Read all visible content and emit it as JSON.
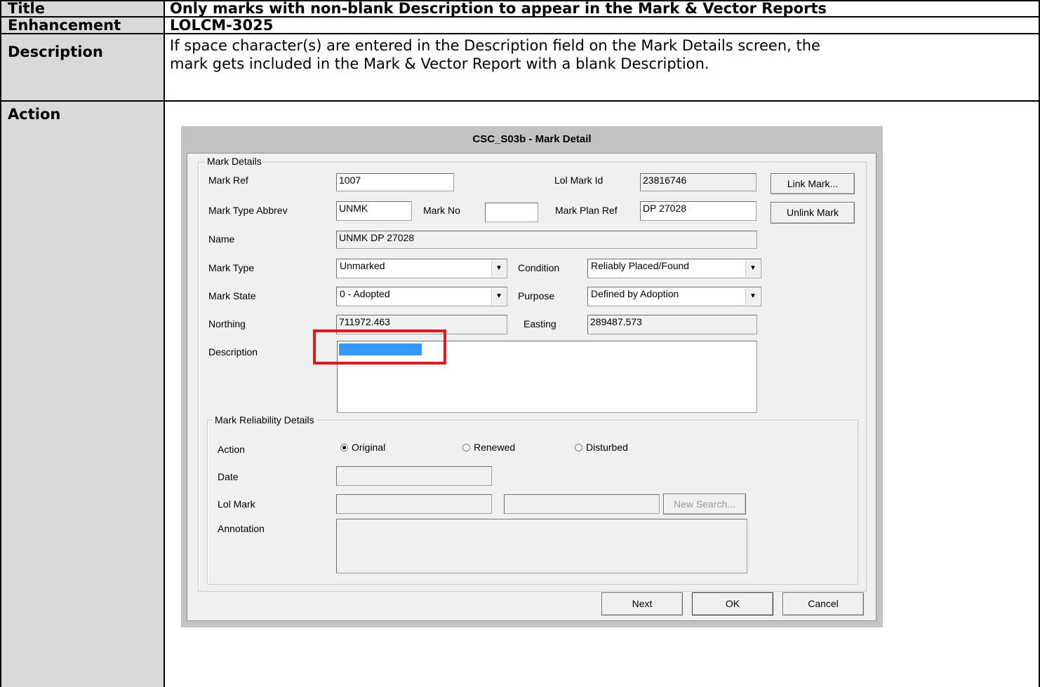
{
  "doc": {
    "rows": [
      {
        "label": "Title",
        "value": "Only marks with non-blank Description to appear in the Mark & Vector Reports"
      },
      {
        "label": "Enhancement",
        "value": "LOLCM-3025"
      },
      {
        "label": "Description",
        "value_line1": "If space character(s) are entered in the Description field on the Mark Details screen, the",
        "value_line2": "mark gets included in the Mark & Vector Report with a blank Description."
      },
      {
        "label": "Action"
      }
    ]
  },
  "dialog": {
    "title": "CSC_S03b - Mark Detail",
    "mark_details": {
      "group_title": "Mark Details",
      "mark_ref_label": "Mark Ref",
      "mark_ref": "1007",
      "lol_mark_id_label": "Lol Mark Id",
      "lol_mark_id": "23816746",
      "link_mark_button": "Link Mark...",
      "mark_type_abbrev_label": "Mark Type Abbrev",
      "mark_type_abbrev": "UNMK",
      "mark_no_label": "Mark No",
      "mark_no": "",
      "mark_plan_ref_label": "Mark Plan Ref",
      "mark_plan_ref": "DP 27028",
      "unlink_mark_button": "Unlink Mark",
      "name_label": "Name",
      "name": "UNMK DP 27028",
      "mark_type_label": "Mark Type",
      "mark_type": "Unmarked",
      "condition_label": "Condition",
      "condition": "Reliably Placed/Found",
      "mark_state_label": "Mark State",
      "mark_state": "0 - Adopted",
      "purpose_label": "Purpose",
      "purpose": "Defined by Adoption",
      "northing_label": "Northing",
      "northing": "711972.463",
      "easting_label": "Easting",
      "easting": "289487.573",
      "description_label": "Description",
      "description": ""
    },
    "reliability": {
      "group_title": "Mark Reliability Details",
      "action_label": "Action",
      "options": [
        "Original",
        "Renewed",
        "Disturbed"
      ],
      "selected": "Original",
      "date_label": "Date",
      "lol_mark_label": "Lol Mark",
      "new_search_button": "New Search...",
      "annotation_label": "Annotation"
    },
    "buttons": {
      "next": "Next",
      "ok": "OK",
      "cancel": "Cancel"
    }
  },
  "colors": {
    "highlight_box": "#e8161c",
    "selection": "#3399ff",
    "label_bg": "#d9d9d9"
  }
}
